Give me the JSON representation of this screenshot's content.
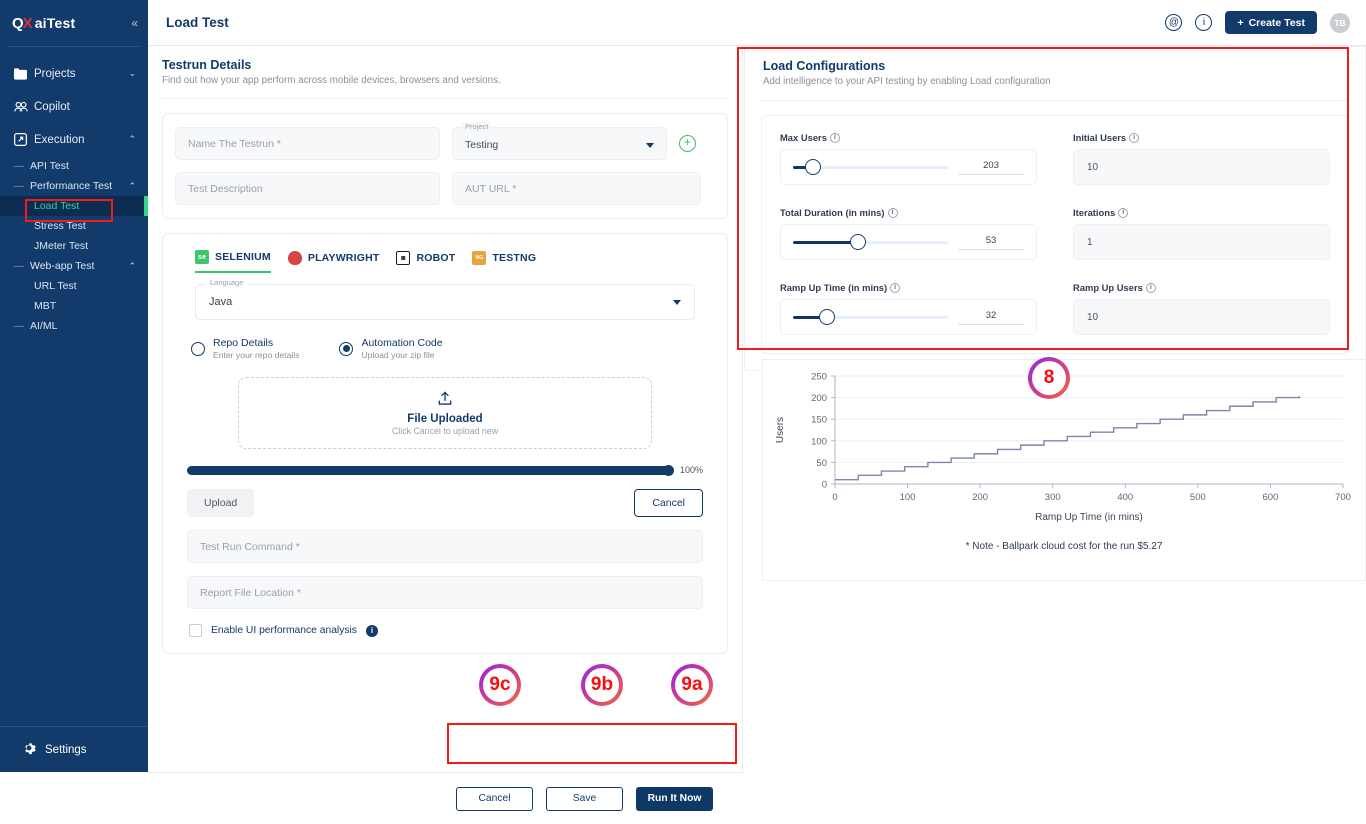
{
  "sidebar": {
    "brand": {
      "mark_q": "Q",
      "mark_x": "X",
      "name": "aiTest",
      "collapse": "«"
    },
    "items": [
      {
        "label": "Projects",
        "icon": "folder-icon",
        "chevron": "⌄"
      },
      {
        "label": "Copilot",
        "icon": "copilot-icon",
        "chevron": ""
      },
      {
        "label": "Execution",
        "icon": "execution-icon",
        "chevron": "⌃"
      }
    ],
    "sub_items": [
      {
        "label": "API Test",
        "dash": "—",
        "chevron": "",
        "active": false,
        "indent": false
      },
      {
        "label": "Performance Test",
        "dash": "—",
        "chevron": "⌃",
        "active": false,
        "indent": false
      },
      {
        "label": "Load Test",
        "dash": "",
        "chevron": "",
        "active": true,
        "indent": true
      },
      {
        "label": "Stress Test",
        "dash": "",
        "chevron": "",
        "active": false,
        "indent": true
      },
      {
        "label": "JMeter Test",
        "dash": "",
        "chevron": "",
        "active": false,
        "indent": true
      },
      {
        "label": "Web-app Test",
        "dash": "—",
        "chevron": "⌃",
        "active": false,
        "indent": false
      },
      {
        "label": "URL Test",
        "dash": "",
        "chevron": "",
        "active": false,
        "indent": true
      },
      {
        "label": "MBT",
        "dash": "",
        "chevron": "",
        "active": false,
        "indent": true
      },
      {
        "label": "AI/ML",
        "dash": "—",
        "chevron": "",
        "active": false,
        "indent": false
      }
    ],
    "settings_label": "Settings"
  },
  "topbar": {
    "title": "Load Test",
    "mention_icon": "@",
    "info_icon": "i",
    "create_test_label": "Create Test",
    "create_test_plus": "+",
    "avatar_initials": "TB"
  },
  "testrun": {
    "title": "Testrun Details",
    "subtitle": "Find out how your app perform across mobile devices, browsers and versions.",
    "name_placeholder": "Name The Testrun *",
    "project_label": "Project",
    "project_value": "Testing",
    "description_placeholder": "Test Description",
    "aut_url_placeholder": "AUT URL *",
    "add_project_icon": "+"
  },
  "frameworks": [
    {
      "label": "SELENIUM",
      "icon": "selenium-icon",
      "active": true
    },
    {
      "label": "PLAYWRIGHT",
      "icon": "playwright-icon",
      "active": false
    },
    {
      "label": "ROBOT",
      "icon": "robot-icon",
      "active": false
    },
    {
      "label": "TESTNG",
      "icon": "testng-icon",
      "active": false
    }
  ],
  "language": {
    "label": "Language",
    "value": "Java"
  },
  "source_options": [
    {
      "title": "Repo Details",
      "subtitle": "Enter your repo details",
      "selected": false
    },
    {
      "title": "Automation Code",
      "subtitle": "Upload your zip file",
      "selected": true
    }
  ],
  "upload": {
    "icon": "upload-icon",
    "title": "File Uploaded",
    "subtitle": "Click Cancel to upload new",
    "progress_label": "100%",
    "progress_value": 100,
    "upload_button": "Upload",
    "cancel_button": "Cancel"
  },
  "commands": {
    "test_run_command_placeholder": "Test Run Command *",
    "report_file_placeholder": "Report File Location *",
    "ui_perf_label": "Enable UI performance analysis",
    "ui_perf_checked": false,
    "info_icon": "i"
  },
  "footer": {
    "cancel": "Cancel",
    "save": "Save",
    "run": "Run It Now"
  },
  "load_config": {
    "title": "Load Configurations",
    "subtitle": "Add intelligence to your API testing by enabling Load configuration",
    "sliders": [
      {
        "label": "Max Users",
        "value": "203",
        "fill_pct": 13
      },
      {
        "label": "Total Duration (in mins)",
        "value": "53",
        "fill_pct": 42
      },
      {
        "label": "Ramp Up Time (in mins)",
        "value": "32",
        "fill_pct": 22
      }
    ],
    "inputs": [
      {
        "label": "Initial Users",
        "value": "10"
      },
      {
        "label": "Iterations",
        "value": "1"
      },
      {
        "label": "Ramp Up Users",
        "value": "10"
      }
    ],
    "note": "* Note - Ballpark cloud cost for the run $5.27"
  },
  "chart_data": {
    "type": "line",
    "title": "",
    "xlabel": "Ramp Up Time (in mins)",
    "ylabel": "Users",
    "xlim": [
      0,
      700
    ],
    "ylim": [
      0,
      250
    ],
    "xticks": [
      0,
      100,
      200,
      300,
      400,
      500,
      600,
      700
    ],
    "yticks": [
      0,
      50,
      100,
      150,
      200,
      250
    ],
    "grid": true,
    "legend": "none",
    "line_color": "#7b86a8",
    "step": true,
    "series": [
      {
        "name": "Users ramp",
        "x": [
          0,
          32,
          32,
          64,
          64,
          96,
          96,
          128,
          128,
          160,
          160,
          192,
          192,
          224,
          224,
          256,
          256,
          288,
          288,
          320,
          320,
          352,
          352,
          384,
          384,
          416,
          416,
          448,
          448,
          480,
          480,
          512,
          512,
          544,
          544,
          576,
          576,
          608,
          608,
          640,
          640
        ],
        "y": [
          10,
          10,
          20,
          20,
          30,
          30,
          40,
          40,
          50,
          50,
          60,
          60,
          70,
          70,
          80,
          80,
          90,
          90,
          100,
          100,
          110,
          110,
          120,
          120,
          130,
          130,
          140,
          140,
          150,
          150,
          160,
          160,
          170,
          170,
          180,
          180,
          190,
          190,
          200,
          200,
          203
        ]
      }
    ]
  },
  "annotations": [
    {
      "id": "8",
      "label": "8"
    },
    {
      "id": "9a",
      "label": "9a"
    },
    {
      "id": "9b",
      "label": "9b"
    },
    {
      "id": "9c",
      "label": "9c"
    }
  ]
}
